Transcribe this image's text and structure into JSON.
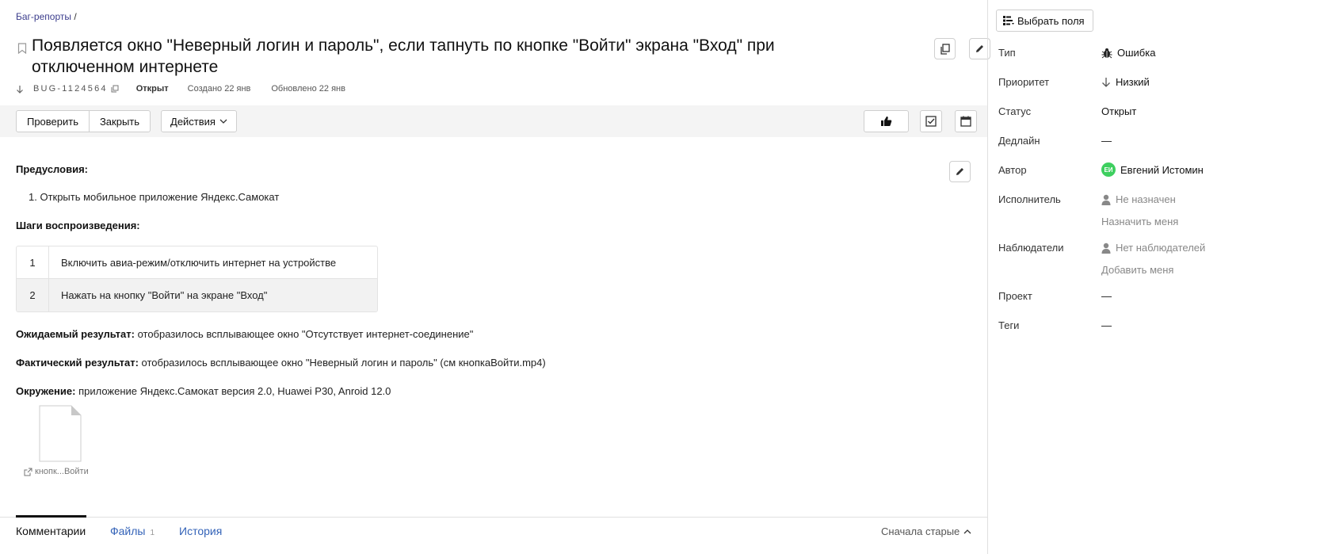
{
  "breadcrumb": {
    "link": "Баг-репорты",
    "separator": " /"
  },
  "issue": {
    "title": "Появляется окно \"Неверный логин и пароль\", если тапнуть по кнопке \"Войти\" экрана \"Вход\" при отключенном интернете",
    "key": "BUG-1124564",
    "status": "Открыт",
    "created": "Создано 22 янв",
    "updated": "Обновлено 22 янв"
  },
  "toolbar": {
    "check_label": "Проверить",
    "close_label": "Закрыть",
    "actions_label": "Действия"
  },
  "description": {
    "preconditions_heading": "Предусловия:",
    "preconditions": [
      "1. Открыть мобильное приложение Яндекс.Самокат"
    ],
    "steps_heading": "Шаги воспроизведения:",
    "steps": [
      {
        "num": "1",
        "text": "Включить авиа-режим/отключить интернет на устройстве"
      },
      {
        "num": "2",
        "text": "Нажать на кнопку \"Войти\" на экране \"Вход\""
      }
    ],
    "expected_label": "Ожидаемый результат:",
    "expected_text": " отобразилось всплывающее окно \"Отсутствует интернет-соединение\"",
    "actual_label": "Фактический результат:",
    "actual_text": " отобразилось всплывающее окно \"Неверный логин и пароль\" (см кнопкаВойти.mp4)",
    "env_label": "Окружение:",
    "env_text": " приложение Яндекс.Самокат версия 2.0, Huawei P30, Anroid 12.0",
    "attachment_name": "кнопк...Войти"
  },
  "tabs": {
    "comments": "Комментарии",
    "files": "Файлы",
    "files_count": "1",
    "history": "История",
    "sort_label": "Сначала старые"
  },
  "sidebar": {
    "choose_fields_label": "Выбрать поля",
    "fields": {
      "type": {
        "label": "Тип",
        "value": "Ошибка",
        "icon": "bug-icon"
      },
      "priority": {
        "label": "Приоритет",
        "value": "Низкий",
        "icon": "arrow-down-icon"
      },
      "status": {
        "label": "Статус",
        "value": "Открыт"
      },
      "deadline": {
        "label": "Дедлайн",
        "value": "—"
      },
      "author": {
        "label": "Автор",
        "value": "Евгений Истомин",
        "initials": "ЕИ",
        "avatar_color": "#3ecf5f"
      },
      "assignee": {
        "label": "Исполнитель",
        "value": "Не назначен",
        "action": "Назначить меня"
      },
      "followers": {
        "label": "Наблюдатели",
        "value": "Нет наблюдателей",
        "action": "Добавить меня"
      },
      "project": {
        "label": "Проект",
        "value": "—"
      },
      "tags": {
        "label": "Теги",
        "value": "—"
      }
    }
  }
}
